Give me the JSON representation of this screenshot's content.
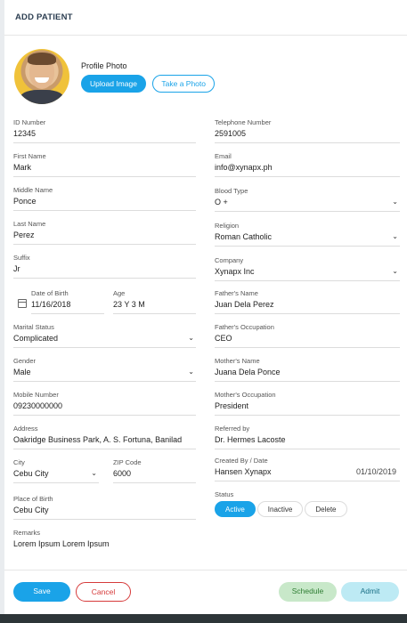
{
  "header": {
    "title": "ADD PATIENT"
  },
  "photo": {
    "label": "Profile Photo",
    "upload_label": "Upload Image",
    "take_label": "Take a Photo"
  },
  "left": {
    "id_number": {
      "label": "ID Number",
      "value": "12345"
    },
    "first_name": {
      "label": "First Name",
      "value": "Mark"
    },
    "middle_name": {
      "label": "Middle Name",
      "value": "Ponce"
    },
    "last_name": {
      "label": "Last Name",
      "value": "Perez"
    },
    "suffix": {
      "label": "Suffix",
      "value": "Jr"
    },
    "dob": {
      "label": "Date of Birth",
      "value": "11/16/2018"
    },
    "age": {
      "label": "Age",
      "value": "23 Y 3 M"
    },
    "marital": {
      "label": "Marital Status",
      "value": "Complicated"
    },
    "gender": {
      "label": "Gender",
      "value": "Male"
    },
    "mobile": {
      "label": "Mobile Number",
      "value": "09230000000"
    },
    "address": {
      "label": "Address",
      "value": "Oakridge Business Park, A. S. Fortuna, Banilad"
    },
    "city": {
      "label": "City",
      "value": "Cebu City"
    },
    "zip": {
      "label": "ZIP Code",
      "value": "6000"
    },
    "birthplace": {
      "label": "Place of Birth",
      "value": "Cebu City"
    },
    "remarks": {
      "label": "Remarks",
      "value": "Lorem Ipsum Lorem Ipsum"
    }
  },
  "right": {
    "telephone": {
      "label": "Telephone Number",
      "value": "2591005"
    },
    "email": {
      "label": "Email",
      "value": "info@xynapx.ph"
    },
    "blood": {
      "label": "Blood Type",
      "value": "O +"
    },
    "religion": {
      "label": "Religion",
      "value": "Roman Catholic"
    },
    "company": {
      "label": "Company",
      "value": "Xynapx Inc"
    },
    "father_name": {
      "label": "Father's Name",
      "value": "Juan Dela Perez"
    },
    "father_occ": {
      "label": "Father's Occupation",
      "value": "CEO"
    },
    "mother_name": {
      "label": "Mother's Name",
      "value": "Juana Dela Ponce"
    },
    "mother_occ": {
      "label": "Mother's Occupation",
      "value": "President"
    },
    "referred": {
      "label": "Referred by",
      "value": "Dr. Hermes Lacoste"
    },
    "created": {
      "label": "Created By / Date",
      "value": "Hansen Xynapx",
      "date": "01/10/2019"
    },
    "status": {
      "label": "Status",
      "options": [
        "Active",
        "Inactive",
        "Delete"
      ]
    }
  },
  "footer": {
    "save": "Save",
    "cancel": "Cancel",
    "schedule": "Schedule",
    "admit": "Admit"
  },
  "colors": {
    "primary": "#1aa3e8",
    "danger": "#d63a3a",
    "schedule_bg": "#c8e8c9",
    "admit_bg": "#bdeaf4"
  }
}
